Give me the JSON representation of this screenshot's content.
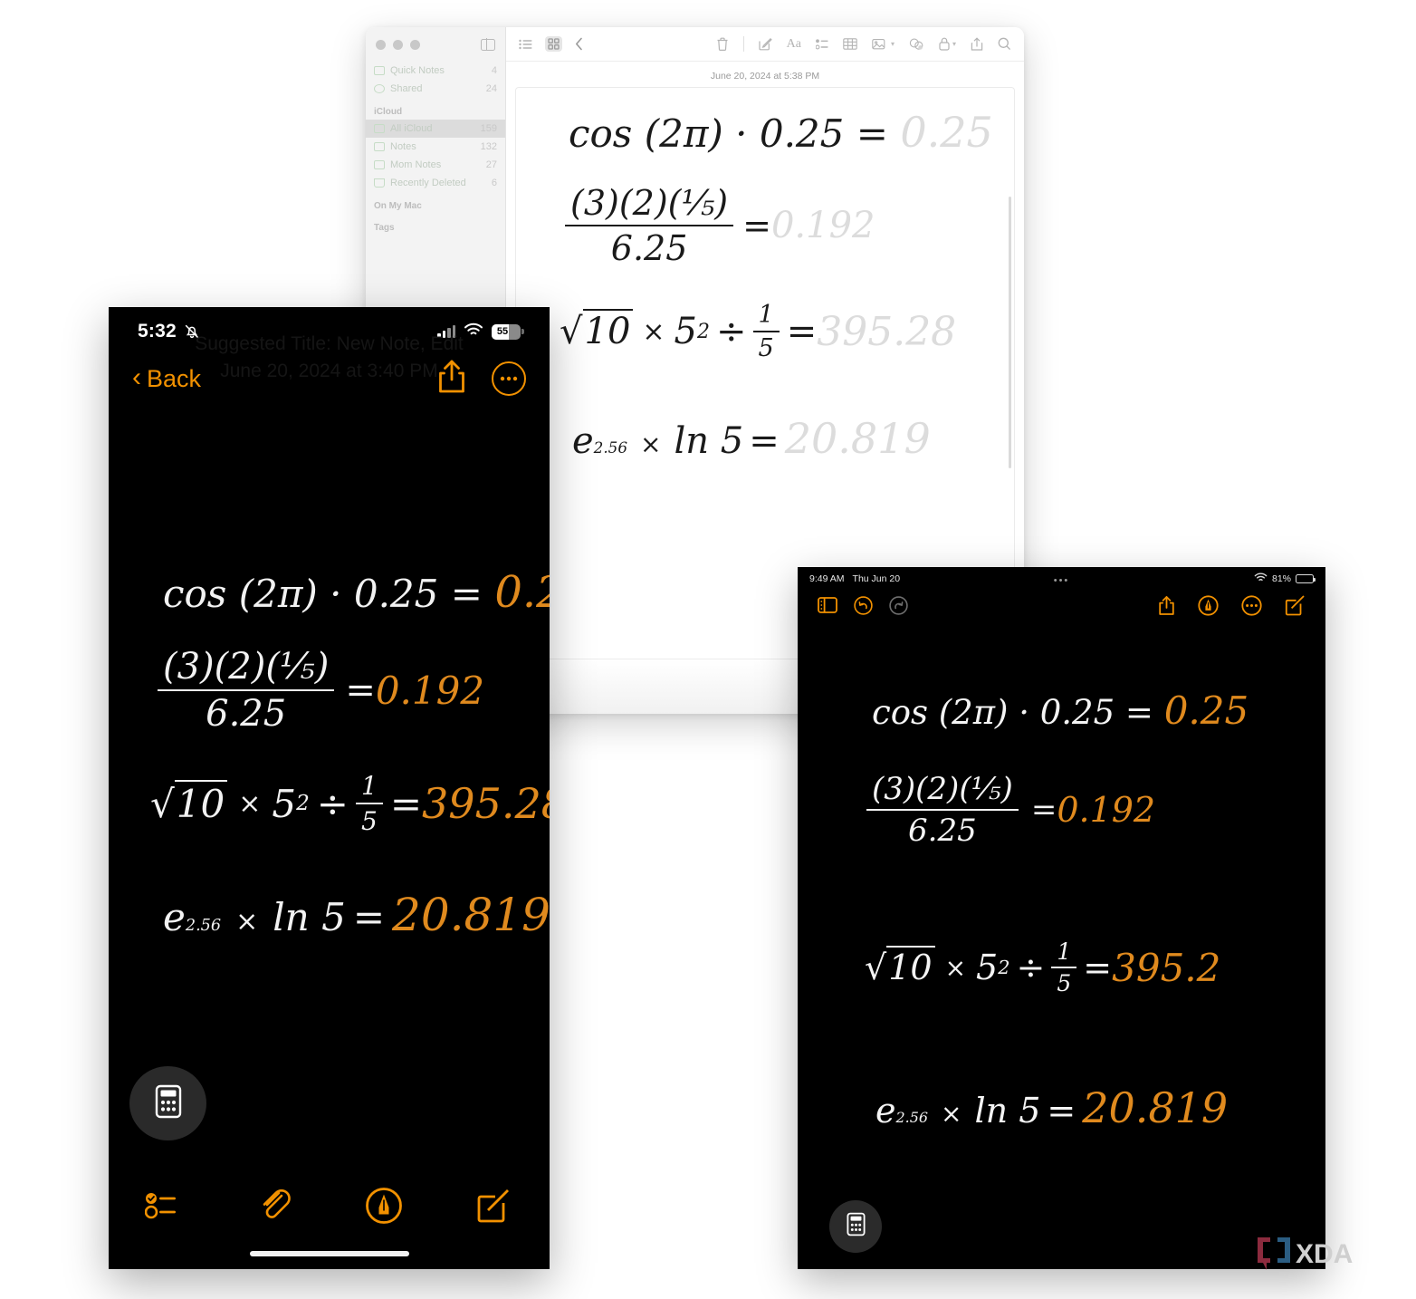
{
  "page": {
    "background": "#ffffff",
    "accent_orange": "#f29100",
    "result_orange": "#e08a1e"
  },
  "mac": {
    "window_title": "Notes",
    "sidebar": {
      "items": [
        {
          "label": "Quick Notes",
          "count": "4",
          "icon": "quick-note-icon"
        },
        {
          "label": "Shared",
          "count": "24",
          "icon": "shared-person-icon"
        }
      ],
      "sections": [
        {
          "header": "iCloud",
          "items": [
            {
              "label": "All iCloud",
              "count": "159",
              "icon": "folder-icon",
              "selected": true
            },
            {
              "label": "Notes",
              "count": "132",
              "icon": "folder-icon",
              "selected": false
            },
            {
              "label": "Mom Notes",
              "count": "27",
              "icon": "folder-icon",
              "selected": false
            },
            {
              "label": "Recently Deleted",
              "count": "6",
              "icon": "trash-icon",
              "selected": false
            }
          ]
        },
        {
          "header": "On My Mac",
          "items": []
        },
        {
          "header": "Tags",
          "items": []
        }
      ]
    },
    "toolbar": {
      "left": [
        {
          "name": "list-view-icon",
          "glyph": "☰"
        },
        {
          "name": "gallery-view-icon",
          "glyph": "▦"
        },
        {
          "name": "back-chevron-icon",
          "glyph": "‹"
        }
      ],
      "right": [
        {
          "name": "trash-icon",
          "glyph": "🗑"
        },
        {
          "name": "compose-icon",
          "glyph": "✎"
        },
        {
          "name": "format-icon",
          "glyph": "Aa"
        },
        {
          "name": "checklist-icon",
          "glyph": "☷"
        },
        {
          "name": "table-icon",
          "glyph": "▦"
        },
        {
          "name": "media-icon",
          "glyph": "🖼"
        },
        {
          "name": "collaborate-icon",
          "glyph": "◍"
        },
        {
          "name": "lock-icon",
          "glyph": "🔒"
        },
        {
          "name": "share-icon",
          "glyph": "↥"
        },
        {
          "name": "search-icon",
          "glyph": "⌕"
        }
      ]
    },
    "note_date": "June 20, 2024 at 5:38 PM"
  },
  "iphone": {
    "status": {
      "time": "5:32",
      "silent_icon": "bell-slash-icon",
      "battery_percent": "55",
      "wifi_icon": "wifi-icon",
      "cellular_icon": "cellular-bars-icon"
    },
    "navbar": {
      "back_label": "Back",
      "share_icon": "share-icon",
      "more_icon": "more-ellipsis-icon",
      "ghost_title": "Suggested Title: New Note, Edit",
      "ghost_date": "June 20, 2024 at 3:40 PM"
    },
    "calculator_button": "calculator-icon",
    "toolbar": [
      {
        "name": "checklist-icon"
      },
      {
        "name": "attachment-paperclip-icon"
      },
      {
        "name": "markup-pen-icon"
      },
      {
        "name": "compose-icon"
      }
    ]
  },
  "ipad": {
    "status": {
      "time": "9:49 AM",
      "date": "Thu Jun 20",
      "battery_percent": "81%",
      "wifi_icon": "wifi-icon",
      "multitask_dots": "•••"
    },
    "toolbar_left": [
      {
        "name": "sidebar-toggle-icon",
        "active": true
      },
      {
        "name": "undo-icon",
        "active": true
      },
      {
        "name": "redo-icon",
        "active": false
      }
    ],
    "toolbar_right": [
      {
        "name": "share-icon"
      },
      {
        "name": "markup-pen-icon"
      },
      {
        "name": "more-ellipsis-icon"
      },
      {
        "name": "compose-icon"
      }
    ],
    "calculator_button": "calculator-icon"
  },
  "math_note": {
    "lines": [
      {
        "id": "line1",
        "expression": "cos (2π) · 0.25 =",
        "result": "0.25",
        "parts": {
          "lhs": "cos (2π) · 0.25",
          "eq": "=",
          "rhs": "0.25"
        }
      },
      {
        "id": "line2",
        "expression": "(3)(2)(1/5) / 6.25 =",
        "result": "0.192",
        "parts": {
          "numerator": "(3)(2)(⅕)",
          "denominator": "6.25",
          "eq": "=",
          "rhs": "0.192"
        }
      },
      {
        "id": "line3",
        "expression": "√10 × 5² ÷ 1/5 =",
        "result_full": "395.28",
        "result_truncated_iphone": "395.28",
        "result_truncated_ipad": "395.2",
        "parts": {
          "radical": "10",
          "times": "×",
          "base": "5",
          "exponent": "2",
          "divide": "÷",
          "fraction_num": "1",
          "fraction_den": "5",
          "eq": "="
        }
      },
      {
        "id": "line4",
        "expression": "e^2.56 × ln 5 =",
        "result": "20.819",
        "parts": {
          "base": "e",
          "exponent": "2.56",
          "times": "×",
          "log": "ln 5",
          "eq": "=",
          "rhs": "20.819"
        }
      }
    ]
  },
  "watermark": {
    "brand": "XDA",
    "bracket_left": "[",
    "bracket_right": "]"
  }
}
